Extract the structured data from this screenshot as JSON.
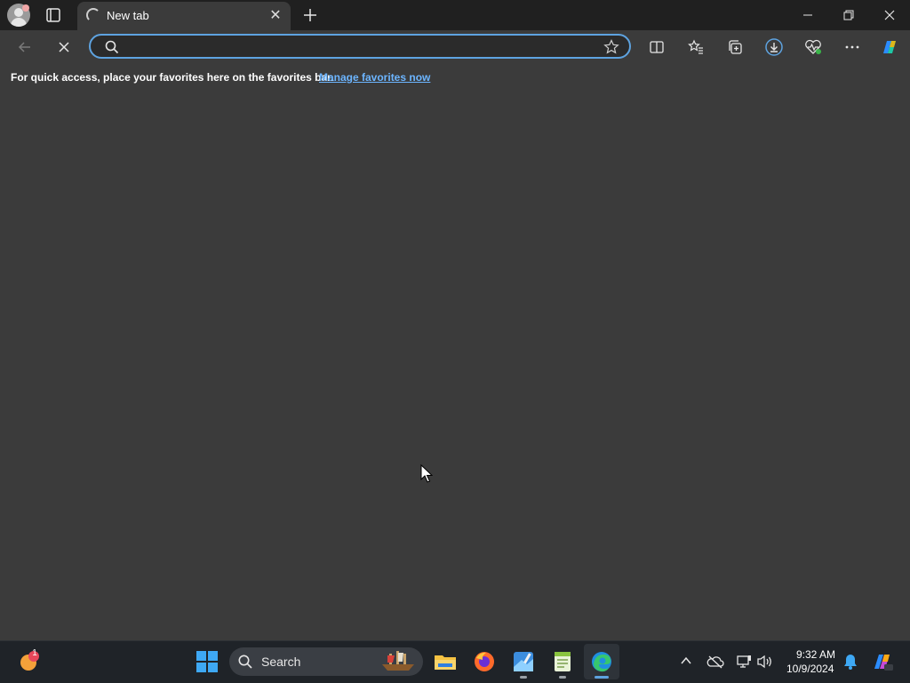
{
  "browser": {
    "tab": {
      "title": "New tab"
    },
    "address_bar": {
      "value": "",
      "placeholder": ""
    },
    "favorites_bar": {
      "message": "For quick access, place your favorites here on the favorites bar.",
      "link_text": "Manage favorites now"
    }
  },
  "taskbar": {
    "search_label": "Search",
    "clock": {
      "time": "9:32 AM",
      "date": "10/9/2024"
    },
    "weather_badge": "1"
  },
  "colors": {
    "accent": "#5ea3e0",
    "link": "#6cb5ff",
    "page_bg": "#3b3b3b",
    "titlebar_bg": "#202020",
    "taskbar_bg": "#1f2328"
  }
}
